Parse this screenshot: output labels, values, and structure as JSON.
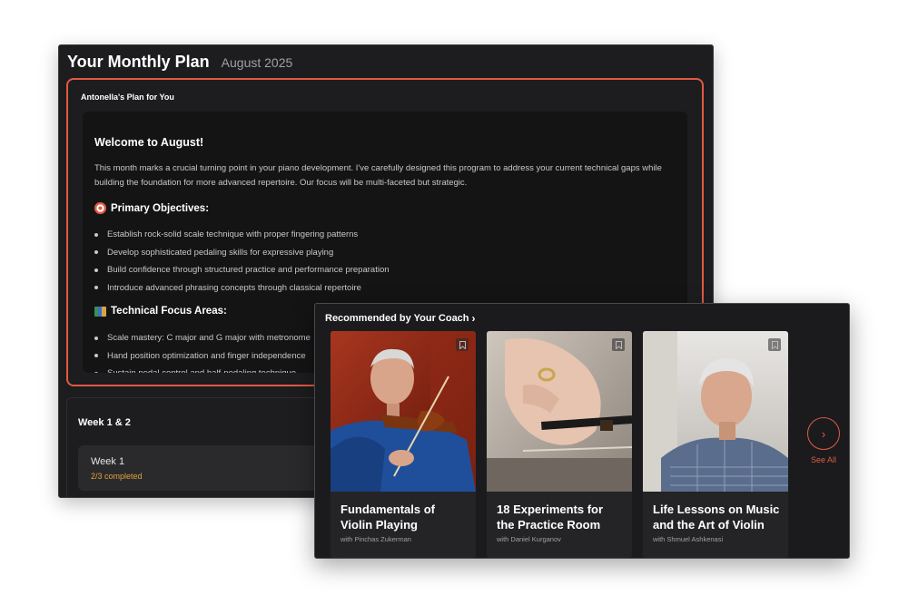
{
  "plan_window": {
    "title": "Your Monthly Plan",
    "month": "August 2025",
    "card_title": "Antonella's Plan for You",
    "welcome_heading": "Welcome to August!",
    "intro": "This month marks a crucial turning point in your piano development. I've carefully designed this program to address your current technical gaps while building the foundation for more advanced repertoire. Our focus will be multi-faceted but strategic.",
    "primary_heading": "Primary Objectives:",
    "primary_icon": "target-icon",
    "primary_items": [
      "Establish rock-solid scale technique with proper fingering patterns",
      "Develop sophisticated pedaling skills for expressive playing",
      "Build confidence through structured practice and performance preparation",
      "Introduce advanced phrasing concepts through classical repertoire"
    ],
    "technical_heading": "Technical Focus Areas:",
    "technical_icon": "books-icon",
    "technical_items": [
      "Scale mastery: C major and G major with metronome",
      "Hand position optimization and finger independence",
      "Sustain pedal control and half-pedaling technique"
    ],
    "week_group_title": "Week 1 & 2",
    "week_label": "Week 1",
    "week_progress": "2/3 completed"
  },
  "recommendations": {
    "header": "Recommended by Your Coach",
    "see_all": "See All",
    "courses": [
      {
        "title": "Fundamentals of Violin Playing",
        "instructor": "with Pinchas Zukerman"
      },
      {
        "title": "18 Experiments for the Practice Room",
        "instructor": "with Daniel Kurganov"
      },
      {
        "title": "Life Lessons on Music and the Art of Violin",
        "instructor": "with Shmuel Ashkenasi"
      }
    ]
  },
  "colors": {
    "accent": "#e05a44",
    "progress": "#e0a43b",
    "background_dark": "#1d1d1f"
  }
}
